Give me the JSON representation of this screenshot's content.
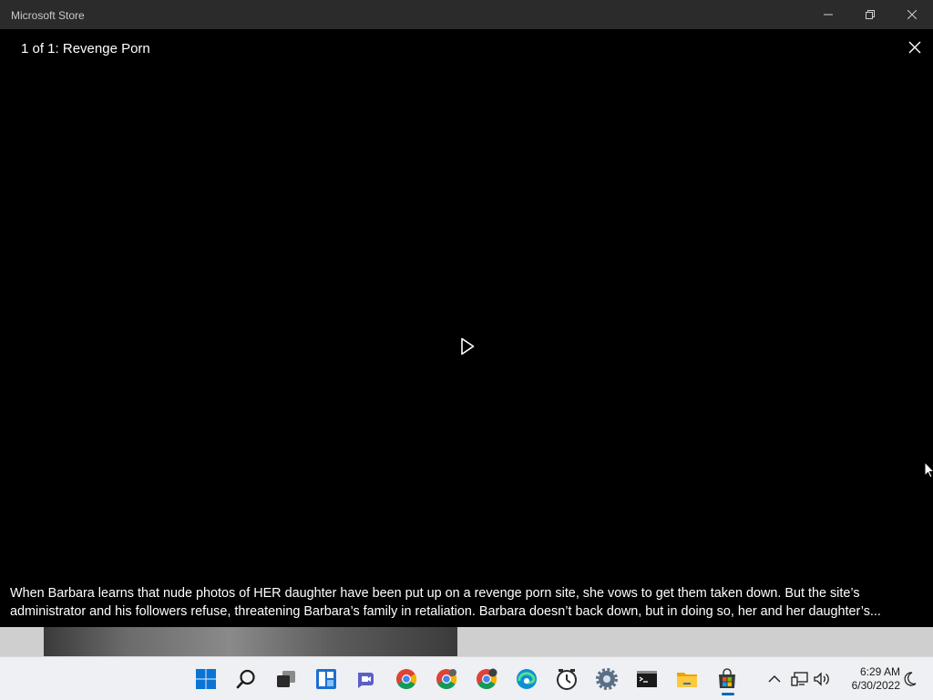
{
  "window": {
    "title": "Microsoft Store",
    "controls": {
      "minimize": "minimize",
      "maximize": "restore",
      "close": "close"
    }
  },
  "viewer": {
    "title": "1 of 1: Revenge Porn",
    "description_lines": [
      "When Barbara learns that nude photos of HER daughter have been put up on a revenge porn site, she vows to get them taken down. But the site’s",
      "administrator and his followers refuse, threatening Barbara’s family in retaliation. Barbara doesn’t back down, but in doing so, her and her daughter’s..."
    ]
  },
  "taskbar": {
    "apps": [
      {
        "name": "start-icon"
      },
      {
        "name": "search-icon"
      },
      {
        "name": "task-view-icon"
      },
      {
        "name": "widgets-icon"
      },
      {
        "name": "teams-chat-icon"
      },
      {
        "name": "chrome-icon"
      },
      {
        "name": "chrome-profile-icon"
      },
      {
        "name": "chrome-profile-badge-icon"
      },
      {
        "name": "edge-icon"
      },
      {
        "name": "clock-app-icon"
      },
      {
        "name": "settings-icon"
      },
      {
        "name": "terminal-icon"
      },
      {
        "name": "file-explorer-icon"
      },
      {
        "name": "microsoft-store-icon",
        "active": true
      }
    ],
    "tray": [
      "chevron-up-icon",
      "network-icon",
      "volume-icon"
    ],
    "time": "6:29 AM",
    "date": "6/30/2022"
  },
  "colors": {
    "accent": "#0067c0",
    "titlebar": "#2b2b2b",
    "taskbar": "#eef0f3"
  }
}
